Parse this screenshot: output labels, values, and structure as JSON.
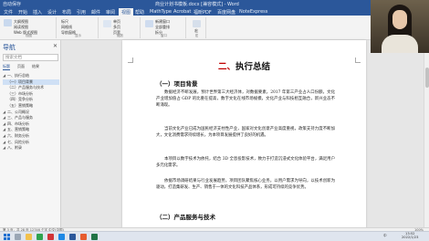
{
  "window": {
    "title": "商业计划书模板.docx [兼容模式] - Word",
    "quick_access": "自动保存"
  },
  "ribbon_tabs": [
    "文件",
    "开始",
    "插入",
    "设计",
    "布局",
    "引用",
    "邮件",
    "审阅",
    "视图",
    "帮助",
    "MathType",
    "Acrobat",
    "福昕PDF",
    "百度网盘",
    "NoteExpress"
  ],
  "ribbon": {
    "g1": [
      "大纲视图",
      "阅读视图",
      "Web 版式视图"
    ],
    "g1_label": "视图",
    "g2": [
      "标尺",
      "网格线",
      "导航窗格"
    ],
    "g2_label": "显示",
    "g3": [
      "单页",
      "多页",
      "页宽"
    ],
    "g3_label": "缩放",
    "g4": [
      "新建窗口",
      "全部重排",
      "拆分"
    ],
    "g4_label": "窗口",
    "g5": [
      "宏"
    ],
    "g5_label": "宏"
  },
  "nav": {
    "title": "导航",
    "close": "✕",
    "search_placeholder": "搜索文档",
    "tabs": [
      "标题",
      "页面",
      "结果"
    ],
    "items": [
      {
        "label": "一、执行总结",
        "selected": false,
        "caret": "◢"
      },
      {
        "label": "（一）项目背景",
        "selected": true,
        "caret": ""
      },
      {
        "label": "（二）产品服务与技术",
        "selected": false,
        "caret": ""
      },
      {
        "label": "（三）市场分析",
        "selected": false,
        "caret": ""
      },
      {
        "label": "（四）竞争分析",
        "selected": false,
        "caret": ""
      },
      {
        "label": "（五）营销策略",
        "selected": false,
        "caret": ""
      },
      {
        "label": "二、公司概况",
        "selected": false,
        "caret": "◢"
      },
      {
        "label": "三、产品与服务",
        "selected": false,
        "caret": "◢"
      },
      {
        "label": "四、市场分析",
        "selected": false,
        "caret": "◢"
      },
      {
        "label": "五、营销策略",
        "selected": false,
        "caret": "◢"
      },
      {
        "label": "六、财务分析",
        "selected": false,
        "caret": "◢"
      },
      {
        "label": "七、风险分析",
        "selected": false,
        "caret": "◢"
      },
      {
        "label": "八、附录",
        "selected": false,
        "caret": "◢"
      }
    ]
  },
  "doc": {
    "heading_num": "二、",
    "heading_text": "执行总结",
    "sub1": "（一）项目背景",
    "p1": "数据经济不断发展，预计世界第三大经济体，对数据要素，2017 年第三产业占人口份额，文化产业增加值占 GDP 的比重在提高，数字文化在线市场规模，文化产业与科技相互融合，新兴业态不断涌现。",
    "p2": "当前文化产业已成为国民经济支柱性产业，国家对文化创意产业高度重视，政策支持力度不断加大，文化消费需求持续增长，为本项目发展提供了良好的机遇。",
    "p3": "本项目以数字技术为依托，结合 3D 全息投影技术，致力于打造沉浸式文化体验平台，满足用户多元化需求。",
    "p4": "依据市场调研结果与行业发展趋势，项目团队聚焦核心业务，以用户需求为导向，以技术创新为驱动，打造集研发、生产、销售于一体的文化科技产品体系，形成可持续的竞争优势。",
    "sub2": "（二）产品服务与技术"
  },
  "status": {
    "left": "第 3 页，共 28 页   12746 个字   中文(中国)",
    "right": "100%"
  },
  "taskbar": {
    "time": "13:52",
    "date": "2022/1/23",
    "lang": "中"
  }
}
